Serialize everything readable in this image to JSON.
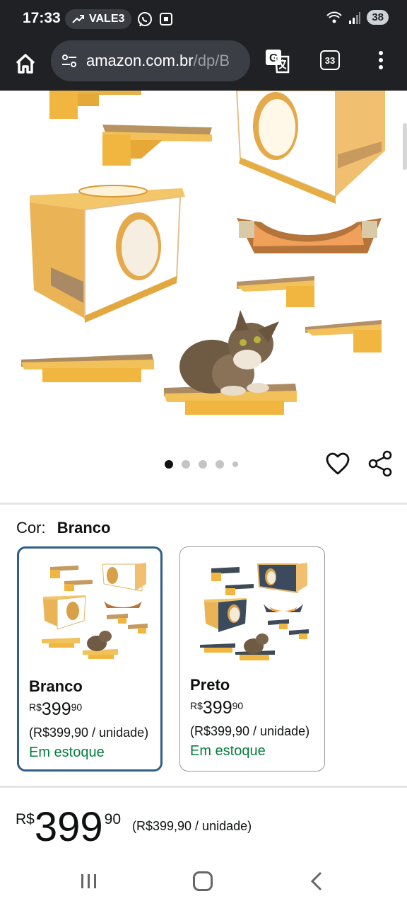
{
  "status_bar": {
    "time": "17:33",
    "ticker": "VALE3",
    "battery": "38"
  },
  "browser": {
    "url_domain": "amazon.com.br",
    "url_path": "/dp/B",
    "tab_count": "33"
  },
  "gallery": {
    "dot_count": 5,
    "active_dot": 1
  },
  "variation": {
    "label": "Cor:",
    "selected_value": "Branco",
    "options": [
      {
        "name": "Branco",
        "currency": "R$",
        "price_whole": "399",
        "price_cents": "90",
        "unit_price": "(R$399,90 / unidade)",
        "stock": "Em estoque",
        "selected": true
      },
      {
        "name": "Preto",
        "currency": "R$",
        "price_whole": "399",
        "price_cents": "90",
        "unit_price": "(R$399,90 / unidade)",
        "stock": "Em estoque",
        "selected": false
      }
    ]
  },
  "buybox": {
    "currency": "R$",
    "price_whole": "399",
    "price_cents": "90",
    "unit_price": "(R$399,90 / unidade)"
  },
  "colors": {
    "stock_green": "#067d3e",
    "selected_border": "#2f5f8a",
    "chrome_dark": "#1f2124"
  },
  "icons": [
    "home-icon",
    "site-settings-icon",
    "translate-icon",
    "tab-switcher-icon",
    "more-menu-icon",
    "heart-icon",
    "share-icon",
    "recent-apps-icon",
    "home-nav-icon",
    "back-icon"
  ]
}
